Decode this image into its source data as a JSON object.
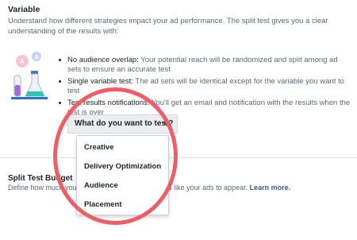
{
  "variable": {
    "title": "Variable",
    "description": "Understand how different strategies impact your ad performance. The split test gives you a clear understanding of the results with:"
  },
  "bullets": [
    {
      "strong": "No audience overlap:",
      "text": " Your potential reach will be randomized and split among ad sets to ensure an accurate test"
    },
    {
      "strong": "Single variable test:",
      "text": " The ad sets will be identical except for the variable you want to test"
    },
    {
      "strong": "Test results notifications:",
      "text": " You'll get an email and notification with the results when the test is over"
    }
  ],
  "dropdown": {
    "label": "What do you want to test?",
    "options": [
      "Creative",
      "Delivery Optimization",
      "Audience",
      "Placement"
    ]
  },
  "budget": {
    "title": "Split Test Budget",
    "description": "Define how much you'd like to spend and how you'd like your ads to appear.",
    "learn_more": "Learn more."
  },
  "icons": {
    "illustration": "ab-test-beakers-icon",
    "dropdown_caret": "caret-down-icon"
  },
  "colors": {
    "highlight_ring": "#ef5d66",
    "link": "#385898"
  }
}
